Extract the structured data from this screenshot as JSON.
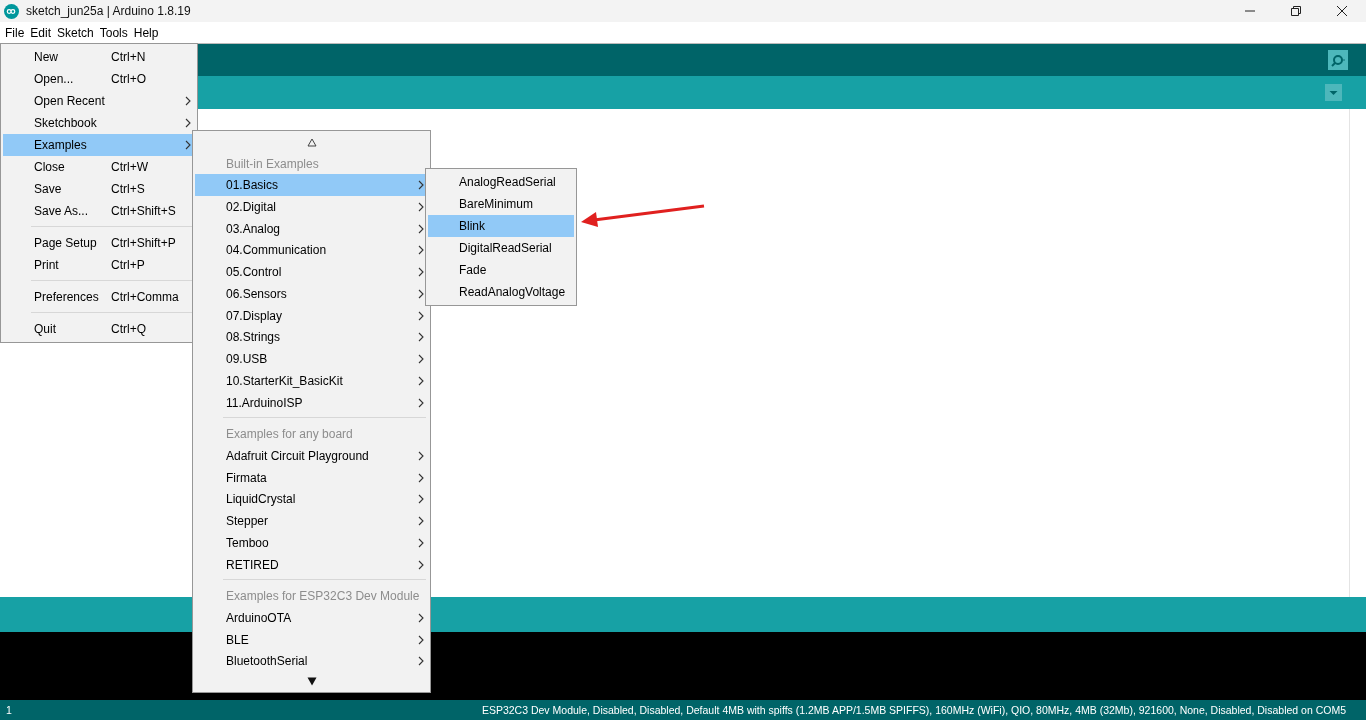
{
  "window": {
    "title": "sketch_jun25a | Arduino 1.8.19"
  },
  "menubar": [
    {
      "label": "File"
    },
    {
      "label": "Edit"
    },
    {
      "label": "Sketch"
    },
    {
      "label": "Tools"
    },
    {
      "label": "Help"
    }
  ],
  "file_menu": {
    "items": [
      {
        "kind": "item",
        "label": "New",
        "shortcut": "Ctrl+N",
        "submenu": false,
        "selected": false
      },
      {
        "kind": "item",
        "label": "Open...",
        "shortcut": "Ctrl+O",
        "submenu": false,
        "selected": false
      },
      {
        "kind": "item",
        "label": "Open Recent",
        "submenu": true,
        "selected": false
      },
      {
        "kind": "item",
        "label": "Sketchbook",
        "submenu": true,
        "selected": false
      },
      {
        "kind": "item",
        "label": "Examples",
        "submenu": true,
        "selected": true
      },
      {
        "kind": "item",
        "label": "Close",
        "shortcut": "Ctrl+W",
        "submenu": false,
        "selected": false
      },
      {
        "kind": "item",
        "label": "Save",
        "shortcut": "Ctrl+S",
        "submenu": false,
        "selected": false
      },
      {
        "kind": "item",
        "label": "Save As...",
        "shortcut": "Ctrl+Shift+S",
        "submenu": false,
        "selected": false
      },
      {
        "kind": "separator"
      },
      {
        "kind": "item",
        "label": "Page Setup",
        "shortcut": "Ctrl+Shift+P",
        "submenu": false,
        "selected": false
      },
      {
        "kind": "item",
        "label": "Print",
        "shortcut": "Ctrl+P",
        "submenu": false,
        "selected": false
      },
      {
        "kind": "separator"
      },
      {
        "kind": "item",
        "label": "Preferences",
        "shortcut": "Ctrl+Comma",
        "submenu": false,
        "selected": false
      },
      {
        "kind": "separator"
      },
      {
        "kind": "item",
        "label": "Quit",
        "shortcut": "Ctrl+Q",
        "submenu": false,
        "selected": false
      }
    ]
  },
  "examples_menu": {
    "items": [
      {
        "kind": "header",
        "label": "Built-in Examples"
      },
      {
        "kind": "item",
        "label": "01.Basics",
        "submenu": true,
        "selected": true
      },
      {
        "kind": "item",
        "label": "02.Digital",
        "submenu": true,
        "selected": false
      },
      {
        "kind": "item",
        "label": "03.Analog",
        "submenu": true,
        "selected": false
      },
      {
        "kind": "item",
        "label": "04.Communication",
        "submenu": true,
        "selected": false
      },
      {
        "kind": "item",
        "label": "05.Control",
        "submenu": true,
        "selected": false
      },
      {
        "kind": "item",
        "label": "06.Sensors",
        "submenu": true,
        "selected": false
      },
      {
        "kind": "item",
        "label": "07.Display",
        "submenu": true,
        "selected": false
      },
      {
        "kind": "item",
        "label": "08.Strings",
        "submenu": true,
        "selected": false
      },
      {
        "kind": "item",
        "label": "09.USB",
        "submenu": true,
        "selected": false
      },
      {
        "kind": "item",
        "label": "10.StarterKit_BasicKit",
        "submenu": true,
        "selected": false
      },
      {
        "kind": "item",
        "label": "11.ArduinoISP",
        "submenu": true,
        "selected": false
      },
      {
        "kind": "separator"
      },
      {
        "kind": "header",
        "label": "Examples for any board"
      },
      {
        "kind": "item",
        "label": "Adafruit Circuit Playground",
        "submenu": true,
        "selected": false
      },
      {
        "kind": "item",
        "label": "Firmata",
        "submenu": true,
        "selected": false
      },
      {
        "kind": "item",
        "label": "LiquidCrystal",
        "submenu": true,
        "selected": false
      },
      {
        "kind": "item",
        "label": "Stepper",
        "submenu": true,
        "selected": false
      },
      {
        "kind": "item",
        "label": "Temboo",
        "submenu": true,
        "selected": false
      },
      {
        "kind": "item",
        "label": "RETIRED",
        "submenu": true,
        "selected": false
      },
      {
        "kind": "separator"
      },
      {
        "kind": "header",
        "label": "Examples for ESP32C3 Dev Module"
      },
      {
        "kind": "item",
        "label": "ArduinoOTA",
        "submenu": true,
        "selected": false
      },
      {
        "kind": "item",
        "label": "BLE",
        "submenu": true,
        "selected": false
      },
      {
        "kind": "item",
        "label": "BluetoothSerial",
        "submenu": true,
        "selected": false
      }
    ]
  },
  "basics_menu": {
    "items": [
      {
        "kind": "item",
        "label": "AnalogReadSerial",
        "submenu": false,
        "selected": false
      },
      {
        "kind": "item",
        "label": "BareMinimum",
        "submenu": false,
        "selected": false
      },
      {
        "kind": "item",
        "label": "Blink",
        "submenu": false,
        "selected": true
      },
      {
        "kind": "item",
        "label": "DigitalReadSerial",
        "submenu": false,
        "selected": false
      },
      {
        "kind": "item",
        "label": "Fade",
        "submenu": false,
        "selected": false
      },
      {
        "kind": "item",
        "label": "ReadAnalogVoltage",
        "submenu": false,
        "selected": false
      }
    ]
  },
  "status_bar": {
    "line": "1",
    "board": "ESP32C3 Dev Module, Disabled, Disabled, Default 4MB with spiffs (1.2MB APP/1.5MB SPIFFS), 160MHz (WiFi), QIO, 80MHz, 4MB (32Mb), 921600, None, Disabled, Disabled on COM5"
  }
}
